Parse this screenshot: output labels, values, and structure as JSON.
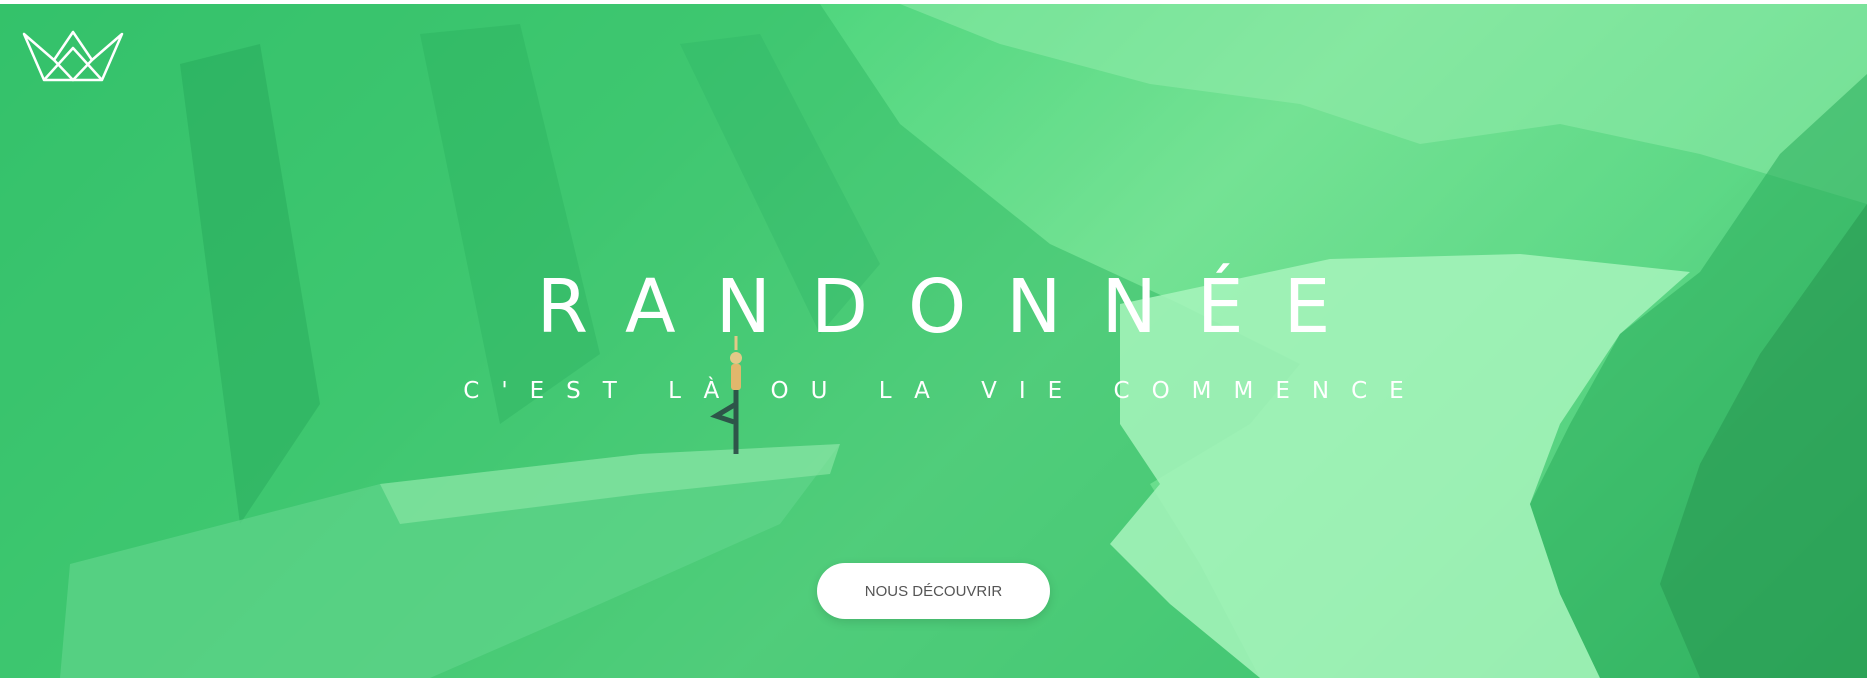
{
  "hero": {
    "title": "RANDONNÉE",
    "subtitle": "C'EST LÀ OU LA VIE COMMENCE",
    "cta_label": "NOUS DÉCOUVRIR"
  },
  "logo": {
    "icon": "crown-icon"
  },
  "colors": {
    "overlay_green": "#49d47a",
    "text": "#ffffff",
    "button_bg": "#ffffff",
    "button_text": "#555555"
  }
}
